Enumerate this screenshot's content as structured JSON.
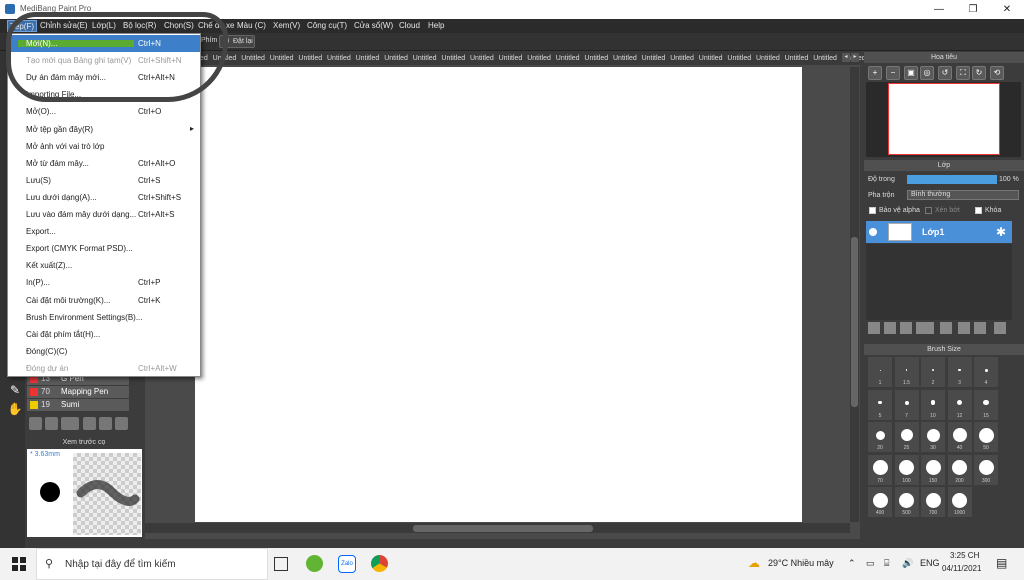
{
  "window": {
    "title": "MediBang Paint Pro"
  },
  "menu": [
    "Tệp(F)",
    "Chỉnh sửa(E)",
    "Lớp(L)",
    "Bộ lọc(R)",
    "Chọn(S)",
    "Chế độ xem(N)",
    "Màu (C)",
    "Xem(V)",
    "Công cụ(T)",
    "Cửa sổ(W)",
    "Cloud",
    "Help"
  ],
  "toolbar": {
    "phim": "Phím",
    "reset_label": "Đặt lại"
  },
  "tab_label": "Untitled",
  "dropdown": [
    {
      "label": "Mới(N)...",
      "shortcut": "Ctrl+N",
      "highlight": true
    },
    {
      "label": "Tạo mới qua Bảng ghi tạm(V)",
      "shortcut": "Ctrl+Shift+N",
      "disabled": true
    },
    {
      "label": "Dự án đám mây mới...",
      "shortcut": "Ctrl+Alt+N"
    },
    {
      "label": "Importing File...",
      "shortcut": ""
    },
    {
      "label": "Mở(O)...",
      "shortcut": "Ctrl+O"
    },
    {
      "label": "Mở tệp gần đây(R)",
      "shortcut": "",
      "submenu": true
    },
    {
      "label": "Mở ảnh với vai trò lớp",
      "shortcut": ""
    },
    {
      "label": "Mở từ đám mây...",
      "shortcut": "Ctrl+Alt+O"
    },
    {
      "label": "Lưu(S)",
      "shortcut": "Ctrl+S"
    },
    {
      "label": "Lưu dưới dạng(A)...",
      "shortcut": "Ctrl+Shift+S"
    },
    {
      "label": "Lưu vào đám mây dưới dạng...",
      "shortcut": "Ctrl+Alt+S"
    },
    {
      "label": "Export...",
      "shortcut": ""
    },
    {
      "label": "Export (CMYK Format PSD)...",
      "shortcut": ""
    },
    {
      "label": "Kết xuất(Z)...",
      "shortcut": ""
    },
    {
      "label": "In(P)...",
      "shortcut": "Ctrl+P"
    },
    {
      "label": "Cài đặt môi trường(K)...",
      "shortcut": "Ctrl+K"
    },
    {
      "label": "Brush Environment Settings(B)...",
      "shortcut": ""
    },
    {
      "label": "Cài đặt phím tắt(H)...",
      "shortcut": ""
    },
    {
      "label": "Đóng(C)(C)",
      "shortcut": ""
    },
    {
      "label": "Đóng dự án",
      "shortcut": "Ctrl+Alt+W",
      "disabled": true
    }
  ],
  "brushes": [
    {
      "num": "13",
      "name": "G Pen",
      "color": "#e33"
    },
    {
      "num": "70",
      "name": "Mapping Pen",
      "color": "#e33"
    },
    {
      "num": "19",
      "name": "Sumi",
      "color": "#ec0"
    }
  ],
  "brush_preview": {
    "title": "Xem trước cọ",
    "size": "* 3.63mm"
  },
  "navigator": {
    "title": "Hoa tiêu"
  },
  "layer_panel": {
    "title": "Lớp",
    "opacity_label": "Độ trong",
    "opacity_value": "100 %",
    "opacity": 1.0,
    "blend_label": "Pha trộn",
    "blend_value": "Bình thường",
    "protect_alpha": "Bảo vệ alpha",
    "clipping": "Xén bớt",
    "lock": "Khóa",
    "layer_name": "Lớp1"
  },
  "brush_size": {
    "title": "Brush Size",
    "sizes": [
      "1",
      "1.5",
      "2",
      "3",
      "4",
      "5",
      "7",
      "10",
      "12",
      "15",
      "20",
      "25",
      "30",
      "40",
      "50",
      "70",
      "100",
      "150",
      "200",
      "300",
      "400",
      "500",
      "700",
      "1000"
    ]
  },
  "taskbar": {
    "search_placeholder": "Nhập tại đây để tìm kiếm",
    "weather": "29°C  Nhiều mây",
    "lang": "ENG",
    "time": "3:25 CH",
    "date": "04/11/2021"
  }
}
